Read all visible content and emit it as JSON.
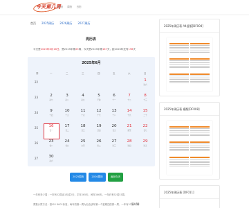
{
  "header": {
    "logo_text": "今天第几周",
    "nav": [
      "首页",
      "周历",
      "日历"
    ]
  },
  "breadcrumb": {
    "home": "首页",
    "links": [
      "2025周历",
      "2026周历",
      "2027周历"
    ]
  },
  "main": {
    "title": "周历表",
    "info": {
      "prefix": "今天是",
      "date": "2025年6月16日",
      "mid1": "，是2025年第",
      "week": "25",
      "mid2": "周，今天是2025年第",
      "day": "167",
      "mid3": "天，距2026年还有",
      "remain": "198",
      "suffix": "天"
    },
    "calendar": {
      "title": "2025年6月",
      "weekdays": [
        "周",
        "一",
        "二",
        "三",
        "四",
        "五",
        "六",
        "日"
      ],
      "weeks": [
        {
          "wk": "22",
          "days": [
            null,
            null,
            null,
            null,
            null,
            null,
            {
              "n": "1",
              "l": "初六",
              "red": true
            }
          ]
        },
        {
          "wk": "23",
          "days": [
            {
              "n": "2",
              "l": "初七"
            },
            {
              "n": "3",
              "l": "初八"
            },
            {
              "n": "4",
              "l": "初九"
            },
            {
              "n": "5",
              "l": "芒种"
            },
            {
              "n": "6",
              "l": "十一"
            },
            {
              "n": "7",
              "l": "十二",
              "red": true
            },
            {
              "n": "8",
              "l": "十三",
              "red": true
            }
          ]
        },
        {
          "wk": "24",
          "days": [
            {
              "n": "9",
              "l": "十四"
            },
            {
              "n": "10",
              "l": "十五"
            },
            {
              "n": "11",
              "l": "十六"
            },
            {
              "n": "12",
              "l": "十七"
            },
            {
              "n": "13",
              "l": "十八"
            },
            {
              "n": "14",
              "l": "十九",
              "red": true
            },
            {
              "n": "15",
              "l": "二十",
              "red": true
            }
          ]
        },
        {
          "wk": "25",
          "days": [
            {
              "n": "16",
              "l": "廿一",
              "red": true
            },
            {
              "n": "17",
              "l": "廿二"
            },
            {
              "n": "18",
              "l": "廿三"
            },
            {
              "n": "19",
              "l": "廿四"
            },
            {
              "n": "20",
              "l": "廿五"
            },
            {
              "n": "21",
              "l": "夏至",
              "red": true
            },
            {
              "n": "22",
              "l": "廿七",
              "red": true
            }
          ]
        },
        {
          "wk": "26",
          "days": [
            {
              "n": "23",
              "l": "廿八"
            },
            {
              "n": "24",
              "l": "廿九"
            },
            {
              "n": "25",
              "l": "六月"
            },
            {
              "n": "26",
              "l": "初二"
            },
            {
              "n": "27",
              "l": "初三"
            },
            {
              "n": "28",
              "l": "初四",
              "red": true
            },
            {
              "n": "29",
              "l": "初五",
              "red": true
            }
          ]
        },
        {
          "wk": "27",
          "days": [
            {
              "n": "30",
              "l": "初六"
            },
            null,
            null,
            null,
            null,
            null,
            null
          ]
        }
      ]
    },
    "buttons": [
      "2025周历",
      "2026周历",
      "返回今天"
    ],
    "bottom_lines": [
      "一年有多少周：一年有52周余1天或2天，平年365天，闰年366天，一年约有52或53周。",
      "周数计算方法：按ISO 8601标准，每年的第一周为包含该年第一个星期四的那一周，一年有52或53周"
    ],
    "page_num": "52/53"
  },
  "sidebar": {
    "cards": [
      {
        "title": "2025年周历表 A4竖版[DF004]"
      },
      {
        "title": "2025年周历表 横版[DF008]"
      },
      {
        "title": "2025年周历表 [DF011]"
      }
    ]
  },
  "colors": {
    "brand": "#d43a26",
    "accent_blue": "#2389e6",
    "accent_green": "#22a043",
    "highlight_red": "#e2323c"
  }
}
